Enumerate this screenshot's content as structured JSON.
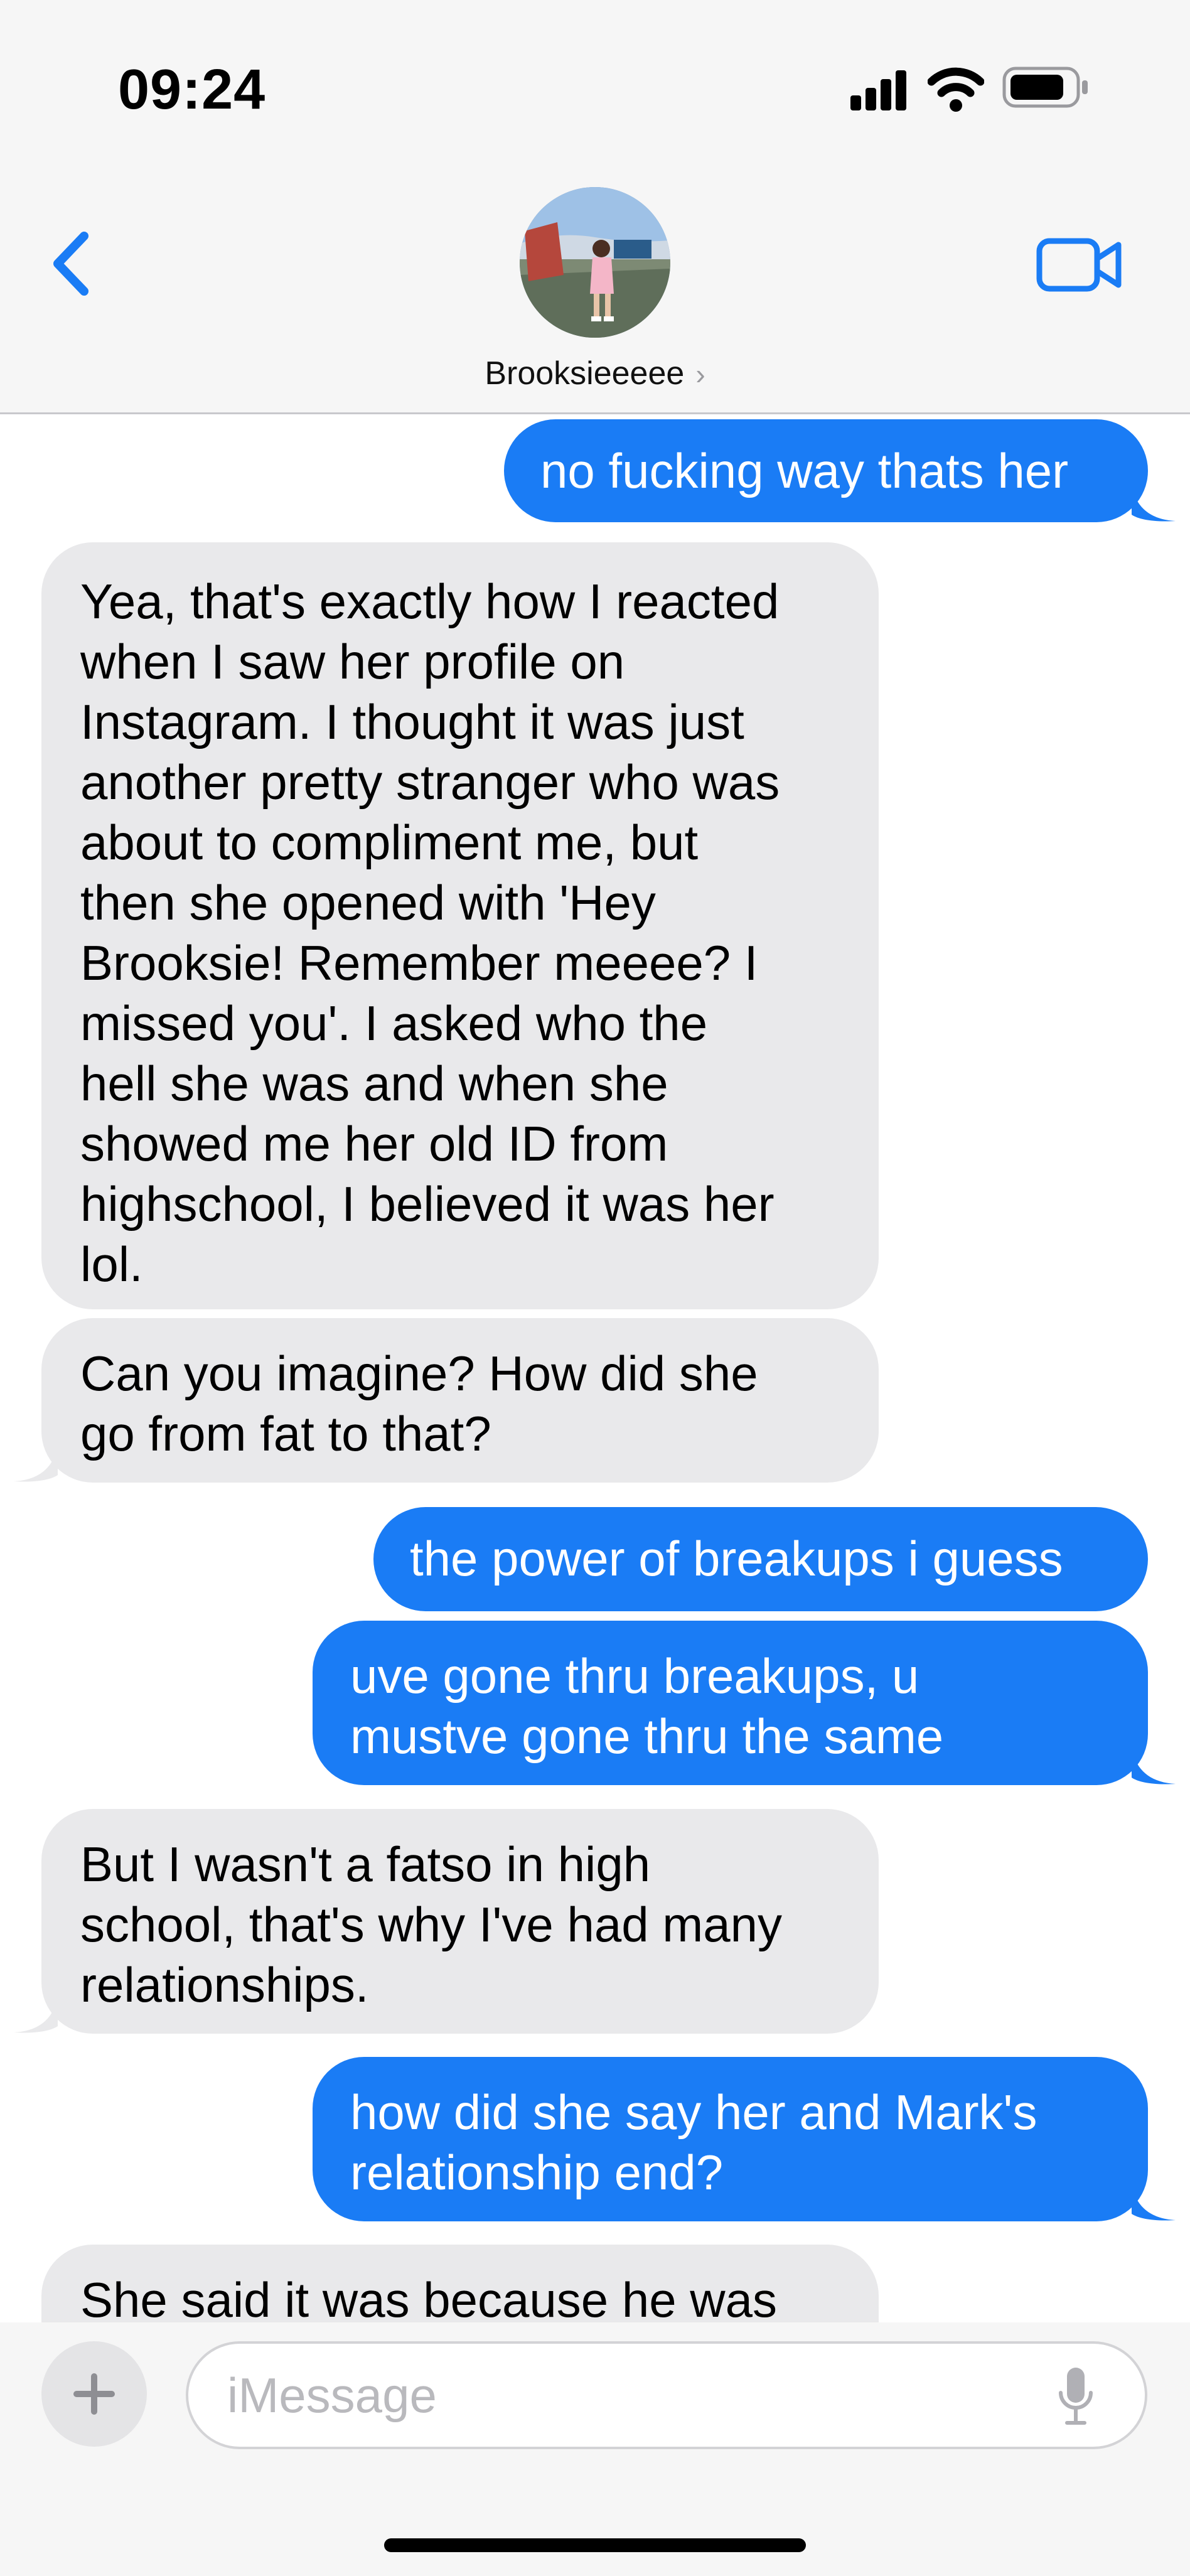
{
  "status_bar": {
    "time": "09:24"
  },
  "header": {
    "contact_name": "Brooksieeeee",
    "chevron": "›"
  },
  "composer": {
    "placeholder": "iMessage",
    "plus": "+"
  },
  "messages": [
    {
      "from": "me",
      "text": "no fucking way thats her"
    },
    {
      "from": "them",
      "text": "Yea, that's exactly how I reacted\nwhen I saw her profile on\nInstagram. I thought it was just\nanother pretty stranger who was\nabout to compliment me, but\nthen she opened with 'Hey\nBrooksie! Remember meeee? I\nmissed you'. I asked who the\nhell she was and when she\nshowed me her old ID from\nhighschool, I believed it was her\nlol."
    },
    {
      "from": "them",
      "text": "Can you imagine? How did she\ngo from fat to that?"
    },
    {
      "from": "me",
      "text": "the power of breakups i guess"
    },
    {
      "from": "me",
      "text": "uve gone thru breakups, u\nmustve gone thru the same"
    },
    {
      "from": "them",
      "text": "But I wasn't a fatso in high\nschool, that's why I've had many\nrelationships."
    },
    {
      "from": "me",
      "text": "how did she say her and Mark's\nrelationship end?"
    },
    {
      "from": "them",
      "text": "She said it was because he was"
    }
  ],
  "colors": {
    "sent_bubble": "#1a7cf5",
    "received_bubble": "#e9e9eb",
    "accent": "#1a7cf5"
  },
  "icons": [
    "back-chevron-icon",
    "video-call-icon",
    "signal-icon",
    "wifi-icon",
    "battery-icon",
    "plus-icon",
    "microphone-icon"
  ]
}
